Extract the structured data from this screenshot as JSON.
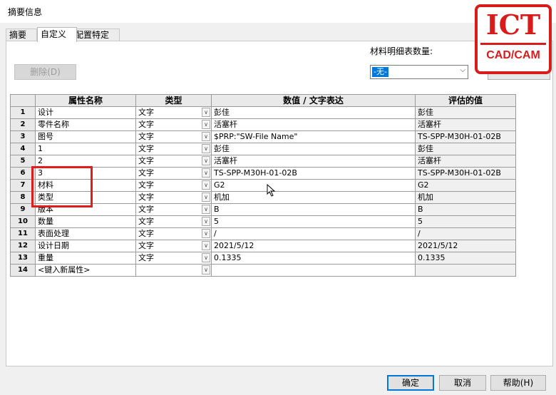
{
  "window": {
    "title": "摘要信息"
  },
  "tabs": [
    {
      "label": "摘要"
    },
    {
      "label": "自定义"
    },
    {
      "label": "配置特定"
    }
  ],
  "toolbar": {
    "delete_label": "删除(D)"
  },
  "bom": {
    "label": "材料明细表数量:",
    "selected": "-无-"
  },
  "grid": {
    "headers": [
      "属性名称",
      "类型",
      "数值 / 文字表达",
      "评估的值"
    ],
    "rows": [
      {
        "num": "1",
        "name": "设计",
        "type": "文字",
        "value": "彭佳",
        "eval": "彭佳"
      },
      {
        "num": "2",
        "name": "零件名称",
        "type": "文字",
        "value": "活塞杆",
        "eval": "活塞杆"
      },
      {
        "num": "3",
        "name": "图号",
        "type": "文字",
        "value": "$PRP:\"SW-File Name\"",
        "eval": "TS-SPP-M30H-01-02B"
      },
      {
        "num": "4",
        "name": "1",
        "type": "文字",
        "value": "彭佳",
        "eval": "彭佳"
      },
      {
        "num": "5",
        "name": "2",
        "type": "文字",
        "value": "活塞杆",
        "eval": "活塞杆"
      },
      {
        "num": "6",
        "name": "3",
        "type": "文字",
        "value": "TS-SPP-M30H-01-02B",
        "eval": "TS-SPP-M30H-01-02B"
      },
      {
        "num": "7",
        "name": "材料",
        "type": "文字",
        "value": "G2",
        "eval": "G2"
      },
      {
        "num": "8",
        "name": "类型",
        "type": "文字",
        "value": "机加",
        "eval": "机加"
      },
      {
        "num": "9",
        "name": "版本",
        "type": "文字",
        "value": "B",
        "eval": "B"
      },
      {
        "num": "10",
        "name": "数量",
        "type": "文字",
        "value": "5",
        "eval": "5"
      },
      {
        "num": "11",
        "name": "表面处理",
        "type": "文字",
        "value": "/",
        "eval": "/"
      },
      {
        "num": "12",
        "name": "设计日期",
        "type": "文字",
        "value": "2021/5/12",
        "eval": "2021/5/12"
      },
      {
        "num": "13",
        "name": "重量",
        "type": "文字",
        "value": "0.1335",
        "eval": "0.1335"
      },
      {
        "num": "14",
        "name": "<键入新属性>",
        "type": "",
        "value": "",
        "eval": ""
      }
    ]
  },
  "footer": {
    "ok_label": "确定",
    "cancel_label": "取消",
    "help_label": "帮助(H)"
  },
  "logo": {
    "main": "ICT",
    "sub": "CAD/CAM"
  },
  "colors": {
    "accent": "#0078d7",
    "highlight_box": "#e01d1d",
    "logo_red": "#d81c1c"
  }
}
